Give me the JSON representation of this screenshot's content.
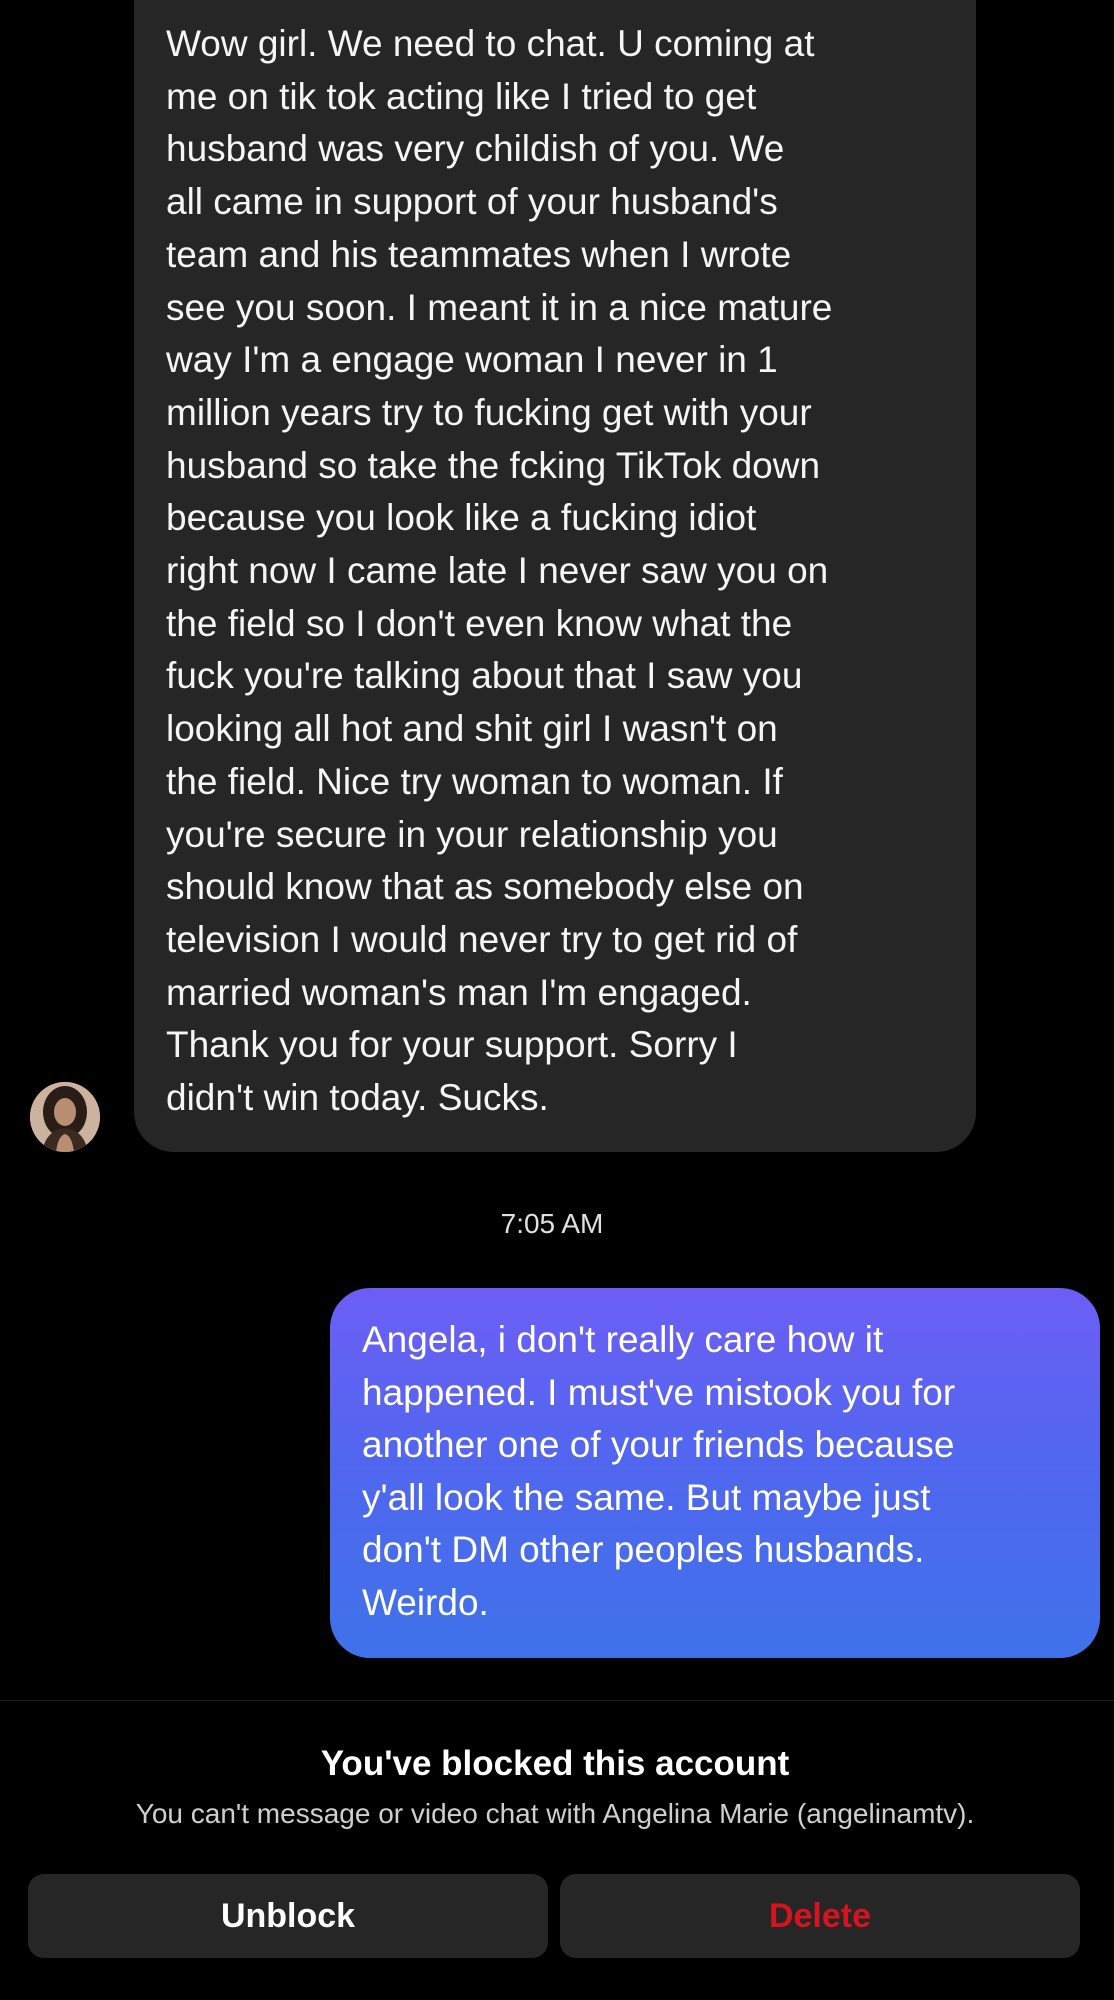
{
  "conversation": {
    "incoming_message": "Wow girl. We need to chat. U coming at\nme on tik tok acting like I tried to get\nhusband was very childish of you. We\nall came in support of your husband's\nteam and his teammates when I wrote\nsee you soon. I meant it in a nice mature\nway I'm a engage woman I never in 1\nmillion years try to fucking get with your\nhusband so take the fcking TikTok down\nbecause you look like a fucking idiot\nright now I came late I never saw you on\nthe field so I don't even know what the\nfuck you're talking about that I saw you\nlooking all hot and shit girl I wasn't on\nthe field. Nice try woman to woman. If\nyou're secure in your relationship you\nshould know that as somebody else on\ntelevision I would never try to get rid of\nmarried woman's man I'm engaged.\nThank you for your support. Sorry I\ndidn't win today. Sucks.",
    "timestamp": "7:05 AM",
    "outgoing_message": "Angela, i don't really care how it\nhappened. I must've mistook you for\nanother one of your friends because\ny'all look the same. But maybe just\ndon't DM other peoples husbands.\nWeirdo."
  },
  "blocked_notice": {
    "title": "You've blocked this account",
    "subtitle": "You can't message or video chat with Angelina Marie (angelinamtv)."
  },
  "actions": {
    "unblock_label": "Unblock",
    "delete_label": "Delete"
  },
  "colors": {
    "background": "#000000",
    "incoming_bubble": "#262626",
    "outgoing_gradient_top": "#6d5ef5",
    "outgoing_gradient_bottom": "#3f72ea",
    "delete_text": "#d4141e"
  },
  "icons": {
    "avatar": "profile-photo"
  }
}
